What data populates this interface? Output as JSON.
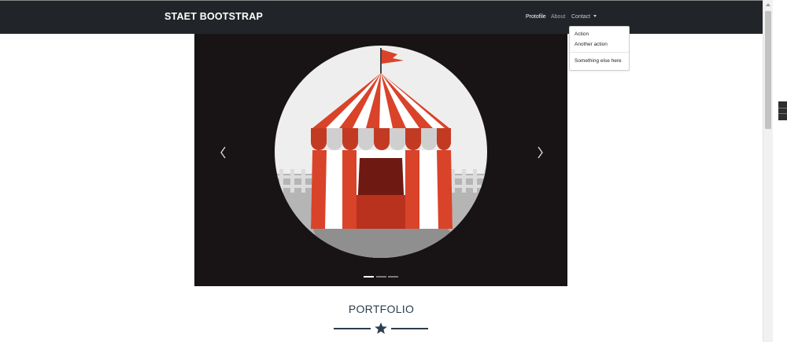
{
  "navbar": {
    "brand": "STAET BOOTSTRAP",
    "links": [
      {
        "label": "Protofile"
      },
      {
        "label": "About"
      },
      {
        "label": "Contact"
      }
    ]
  },
  "dropdown": {
    "items": [
      {
        "label": "Action"
      },
      {
        "label": "Another action"
      },
      {
        "label": "Something else here"
      }
    ]
  },
  "carousel": {
    "slide_icon": "circus-tent-image",
    "prev_icon": "chevron-left-icon",
    "next_icon": "chevron-right-icon",
    "indicators": 3,
    "active_index": 0
  },
  "section": {
    "title": "PORTFOLIO",
    "divider_icon": "star-icon"
  },
  "colors": {
    "navbar_bg": "#212529",
    "carousel_bg": "#181416",
    "tent_red": "#d9432a",
    "heading": "#2c3e50"
  }
}
